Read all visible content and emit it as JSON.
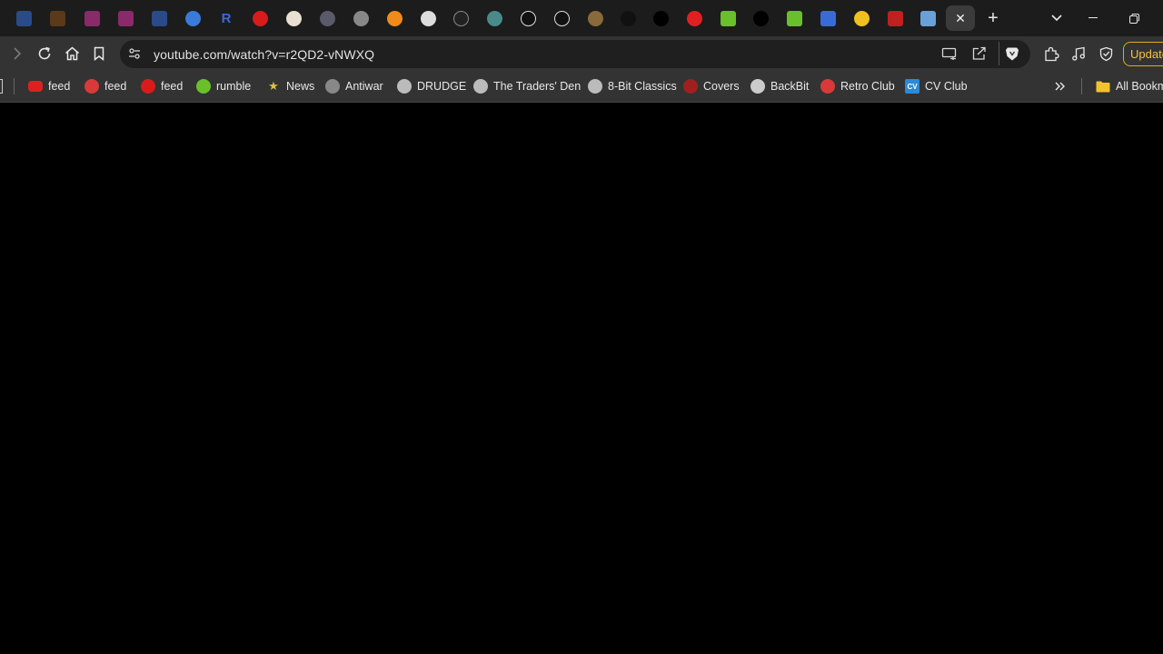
{
  "tabs": {
    "active_close_glyph": "✕",
    "new_tab_glyph": "+",
    "items": [
      {
        "icon": "mail-icon",
        "color": "#2a4a8a"
      },
      {
        "icon": "ups-icon",
        "color": "#5a3a1a"
      },
      {
        "icon": "news-logo-icon",
        "color": "#8a2a6a"
      },
      {
        "icon": "news-logo-icon",
        "color": "#8a2a6a"
      },
      {
        "icon": "mail-icon",
        "color": "#2a4a8a"
      },
      {
        "icon": "shield-blue-icon",
        "color": "#3a7ad8"
      },
      {
        "icon": "r-letter-icon",
        "color": "#3a6ad8",
        "text": "R"
      },
      {
        "icon": "red-circle-icon",
        "color": "#d81b1b"
      },
      {
        "icon": "skull-icon",
        "color": "#e8e0d0"
      },
      {
        "icon": "globe-icon",
        "color": "#5a5a6a"
      },
      {
        "icon": "grey-circle-icon",
        "color": "#888888"
      },
      {
        "icon": "bitcoin-icon",
        "color": "#f08a1a"
      },
      {
        "icon": "horse-icon",
        "color": "#dddddd"
      },
      {
        "icon": "empty-circle-icon",
        "color": "#222222"
      },
      {
        "icon": "globe-icon",
        "color": "#4a8a8a"
      },
      {
        "icon": "h-letter-icon",
        "color": "#ffffff"
      },
      {
        "icon": "m-letter-icon",
        "color": "#ffffff"
      },
      {
        "icon": "coin-icon",
        "color": "#8a6a3a"
      },
      {
        "icon": "dark-circle-icon",
        "color": "#111111"
      },
      {
        "icon": "number-icon",
        "color": "#000000"
      },
      {
        "icon": "youtube-icon",
        "color": "#e02020"
      },
      {
        "icon": "rt-icon",
        "color": "#6ac02a"
      },
      {
        "icon": "number-icon",
        "color": "#000000"
      },
      {
        "icon": "rt-icon",
        "color": "#6ac02a"
      },
      {
        "icon": "user-icon",
        "color": "#3a6ad8"
      },
      {
        "icon": "star-icon",
        "color": "#f0c020"
      },
      {
        "icon": "flag-icon",
        "color": "#c02020"
      },
      {
        "icon": "app-icon",
        "color": "#6aa0d8"
      }
    ]
  },
  "toolbar": {
    "url": "youtube.com/watch?v=r2QD2-vNWXQ",
    "update_label": "Update"
  },
  "bookmarks": {
    "items": [
      {
        "label": "feed",
        "icon": "youtube-icon",
        "color": "#e02020"
      },
      {
        "label": "feed",
        "icon": "panda-icon",
        "color": "#d83a3a"
      },
      {
        "label": "feed",
        "icon": "c-logo-icon",
        "color": "#d81b1b"
      },
      {
        "label": "rumble",
        "icon": "rumble-icon",
        "color": "#6ac02a"
      },
      {
        "label": "News",
        "icon": "star-icon",
        "color": "#e0c040"
      },
      {
        "label": "Antiwar",
        "icon": "antiwar-icon",
        "color": "#888888"
      },
      {
        "label": "DRUDGE",
        "icon": "drudge-icon",
        "color": "#bbbbbb"
      },
      {
        "label": "The Traders' Den",
        "icon": "traders-icon",
        "color": "#bbbbbb"
      },
      {
        "label": "8-Bit Classics",
        "icon": "ship-icon",
        "color": "#bbbbbb"
      },
      {
        "label": "Covers",
        "icon": "covers-icon",
        "color": "#a02020"
      },
      {
        "label": "BackBit",
        "icon": "backbit-icon",
        "color": "#cccccc"
      },
      {
        "label": "Retro Club",
        "icon": "retro-icon",
        "color": "#d83a3a"
      },
      {
        "label": "CV Club",
        "icon": "cv-icon",
        "color": "#2a8ad8",
        "text": "CV"
      }
    ],
    "all_bookmarks_label": "All Bookmarks"
  }
}
